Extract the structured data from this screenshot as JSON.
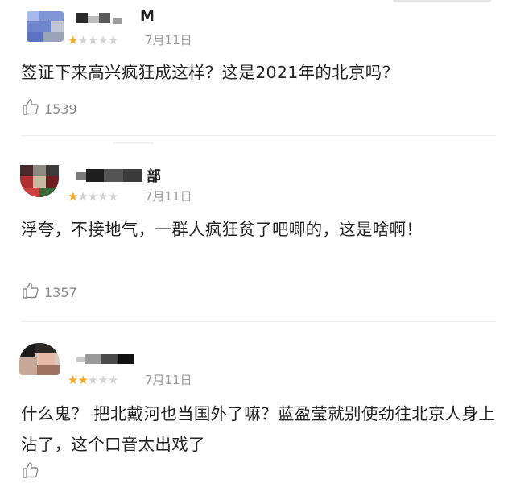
{
  "reviews": [
    {
      "username": "M",
      "stars_filled": 1,
      "stars_total": 5,
      "date": "7月11日",
      "comment": "签证下来高兴疯狂成这样？这是2021年的北京吗？",
      "likes": "1539"
    },
    {
      "username": "部",
      "stars_filled": 1,
      "stars_total": 5,
      "date": "7月11日",
      "comment": "浮夸，不接地气，一群人疯狂贫了吧唧的，这是啥啊！",
      "likes": "1357"
    },
    {
      "username": "",
      "stars_filled": 2,
      "stars_total": 5,
      "date": "7月11日",
      "comment": "什么鬼？ 把北戴河也当国外了嘛？蓝盈莹就别使劲往北京人身上沾了，这个口音太出戏了",
      "likes": ""
    }
  ],
  "icons": {
    "like": "thumbs-up-icon",
    "star": "star-icon"
  },
  "colors": {
    "star_on": "#f5a623",
    "star_off": "#d4d4d4",
    "muted": "#9a9a9a"
  }
}
